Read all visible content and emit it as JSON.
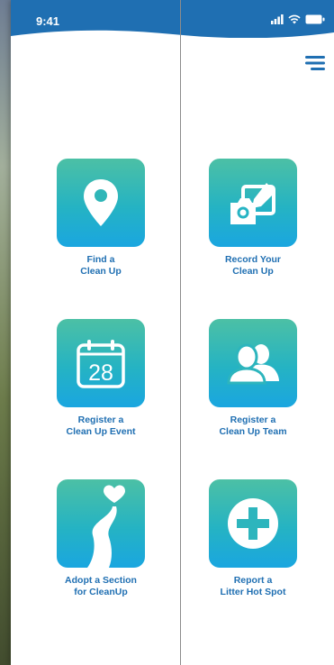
{
  "status": {
    "time": "9:41"
  },
  "tiles": [
    {
      "label": "Find a\nClean Up",
      "icon": "map-pin-icon"
    },
    {
      "label": "Record Your\nClean Up",
      "icon": "camera-edit-icon"
    },
    {
      "label": "Register a\nClean Up Event",
      "icon": "calendar-icon",
      "calendar_day": "28"
    },
    {
      "label": "Register a\nClean Up Team",
      "icon": "team-icon"
    },
    {
      "label": "Adopt a Section\nfor CleanUp",
      "icon": "heart-road-icon"
    },
    {
      "label": "Report  a\nLitter Hot Spot",
      "icon": "plus-circle-icon"
    }
  ],
  "colors": {
    "header": "#1f6fb2",
    "tile_top": "#4cc0a5",
    "tile_bottom": "#1aa6e0",
    "label": "#1f6fb2"
  }
}
